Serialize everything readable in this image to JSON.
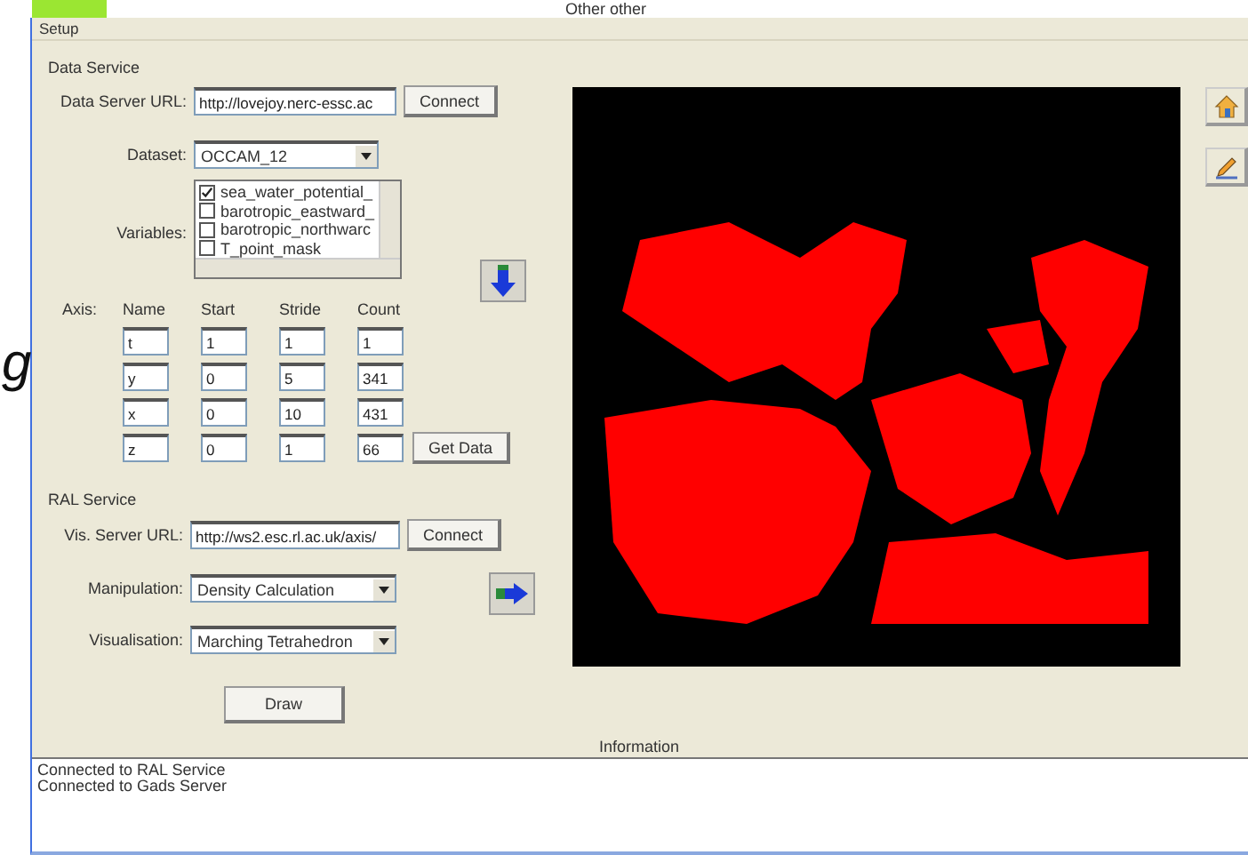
{
  "top_strip": {
    "caption": "Other other"
  },
  "side_fragment": "g",
  "window": {
    "title": "Setup"
  },
  "data_service": {
    "heading": "Data Service",
    "url_label": "Data Server URL:",
    "url_value": "http://lovejoy.nerc-essc.ac",
    "connect_button": "Connect",
    "dataset_label": "Dataset:",
    "dataset_value": "OCCAM_12",
    "variables_label": "Variables:",
    "variables": [
      {
        "name": "sea_water_potential_",
        "checked": true
      },
      {
        "name": "barotropic_eastward_",
        "checked": false
      },
      {
        "name": "barotropic_northwarc",
        "checked": false
      },
      {
        "name": "T_point_mask",
        "checked": false
      }
    ],
    "axes": {
      "headers": [
        "Axis:",
        "Name",
        "Start",
        "Stride",
        "Count"
      ],
      "rows": [
        [
          "t",
          "1",
          "1",
          "1"
        ],
        [
          "y",
          "0",
          "5",
          "341"
        ],
        [
          "x",
          "0",
          "10",
          "431"
        ],
        [
          "z",
          "0",
          "1",
          "66"
        ]
      ]
    },
    "get_data_button": "Get Data"
  },
  "ral_service": {
    "heading": "RAL Service",
    "vis_label": "Vis. Server URL:",
    "vis_value": "http://ws2.esc.rl.ac.uk/axis/",
    "connect_button": "Connect",
    "manipulation_label": "Manipulation:",
    "manipulation_value": "Density Calculation",
    "visualisation_label": "Visualisation:",
    "visualisation_value": "Marching Tetrahedron"
  },
  "draw_button": "Draw",
  "information": {
    "title": "Information",
    "lines": [
      "Connected to RAL Service",
      "Connected to Gads Server"
    ]
  }
}
